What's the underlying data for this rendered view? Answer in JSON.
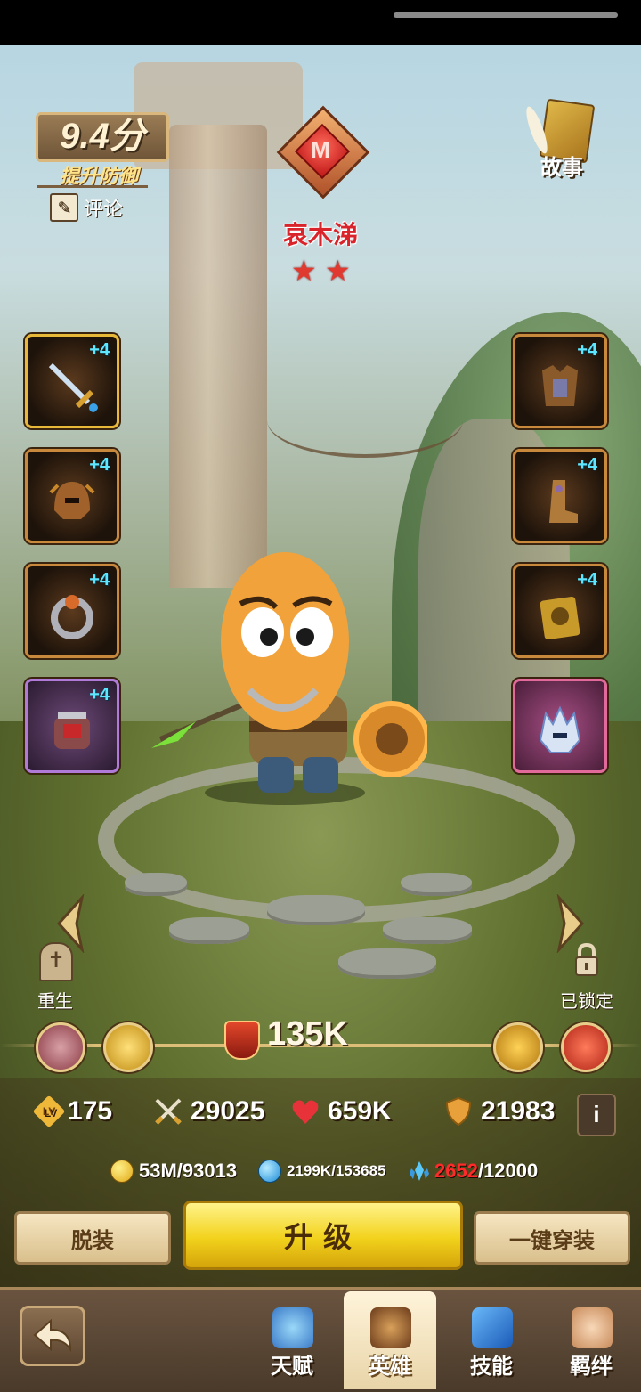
{
  "hero": {
    "rating": "9.4分",
    "rating_tip": "提升防御",
    "review_label": "评论",
    "name": "哀木涕",
    "stars": [
      "★",
      "★"
    ],
    "emblem_letter": "M"
  },
  "story_label": "故事",
  "equipment": {
    "left": [
      {
        "icon": "sword-icon",
        "plus": "+4",
        "frame": "gold"
      },
      {
        "icon": "helmet-icon",
        "plus": "+4",
        "frame": "orange"
      },
      {
        "icon": "ring-icon",
        "plus": "+4",
        "frame": "orange"
      },
      {
        "icon": "gauntlet-icon",
        "plus": "+4",
        "frame": "purple"
      }
    ],
    "right": [
      {
        "icon": "chest-armor-icon",
        "plus": "+4",
        "frame": "orange"
      },
      {
        "icon": "boots-icon",
        "plus": "+4",
        "frame": "orange"
      },
      {
        "icon": "tome-icon",
        "plus": "+4",
        "frame": "orange"
      },
      {
        "icon": "ice-helm-icon",
        "plus": "",
        "frame": "pink"
      }
    ]
  },
  "rebirth_label": "重生",
  "locked_label": "已锁定",
  "power": "135K",
  "stats": {
    "level_badge": "LV",
    "level": "175",
    "attack": "29025",
    "hp": "659K",
    "defense": "21983",
    "info": "i"
  },
  "resources": {
    "gold": "53M/93013",
    "exp": "2199K/153685",
    "crystal_have": "2652",
    "crystal_need": "/12000"
  },
  "buttons": {
    "unequip": "脱装",
    "upgrade": "升级",
    "equip_all": "一键穿装"
  },
  "nav": {
    "tabs": [
      "天赋",
      "英雄",
      "技能",
      "羁绊"
    ],
    "active": "英雄"
  },
  "colors": {
    "accent_gold": "#f2d21c",
    "name_red": "#d8242a",
    "plus_cyan": "#5ee6ff",
    "insufficient_red": "#ff2a2a"
  }
}
